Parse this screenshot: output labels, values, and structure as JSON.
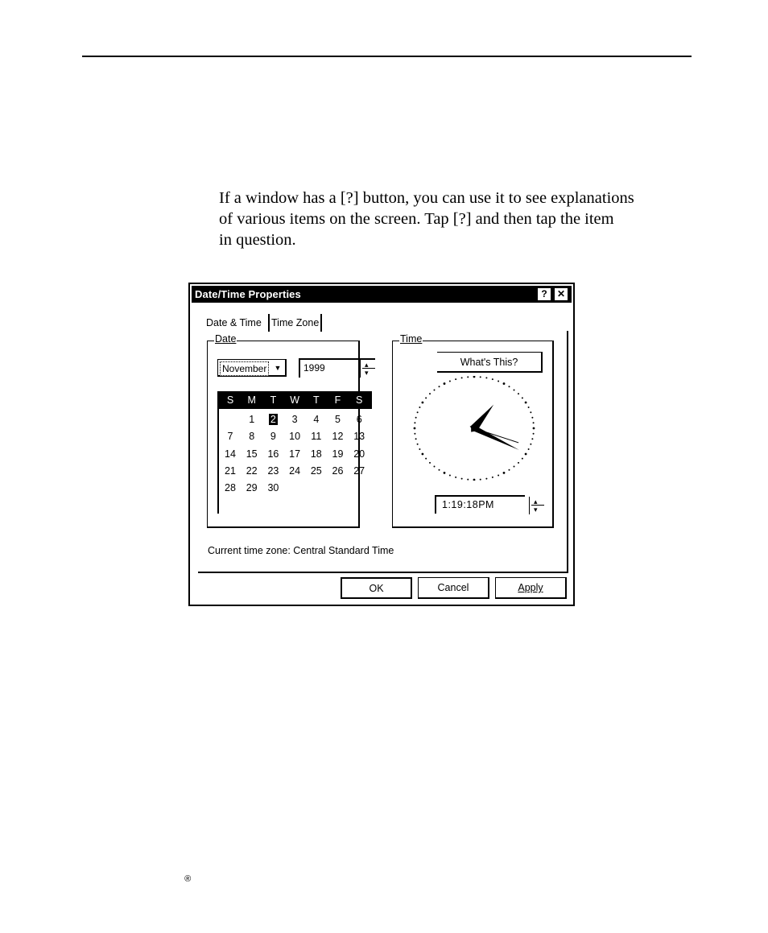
{
  "intro": {
    "lines": [
      "If a window has a [?] button, you can use it to see explanations",
      "of various items on the screen.  Tap [?] and then tap the item",
      "in question."
    ]
  },
  "dialog": {
    "title": "Date/Time Properties",
    "help_label": "?",
    "close_label": "✕",
    "tabs": [
      "Date & Time",
      "Time Zone"
    ],
    "date_group": {
      "label": "Date",
      "month": "November",
      "year": "1999",
      "weekdays": [
        "S",
        "M",
        "T",
        "W",
        "T",
        "F",
        "S"
      ],
      "days": [
        "1",
        "2",
        "3",
        "4",
        "5",
        "6",
        "7",
        "8",
        "9",
        "10",
        "11",
        "12",
        "13",
        "14",
        "15",
        "16",
        "17",
        "18",
        "19",
        "20",
        "21",
        "22",
        "23",
        "24",
        "25",
        "26",
        "27",
        "28",
        "29",
        "30"
      ],
      "selected_day": "2"
    },
    "time_group": {
      "label": "Time",
      "whats_this": "What's This?",
      "time_value": "1:19:18PM"
    },
    "current_tz": "Current time zone:  Central Standard Time",
    "buttons": {
      "ok": "OK",
      "cancel": "Cancel",
      "apply": "Apply"
    }
  },
  "footer": {
    "reg_mark": "®"
  }
}
